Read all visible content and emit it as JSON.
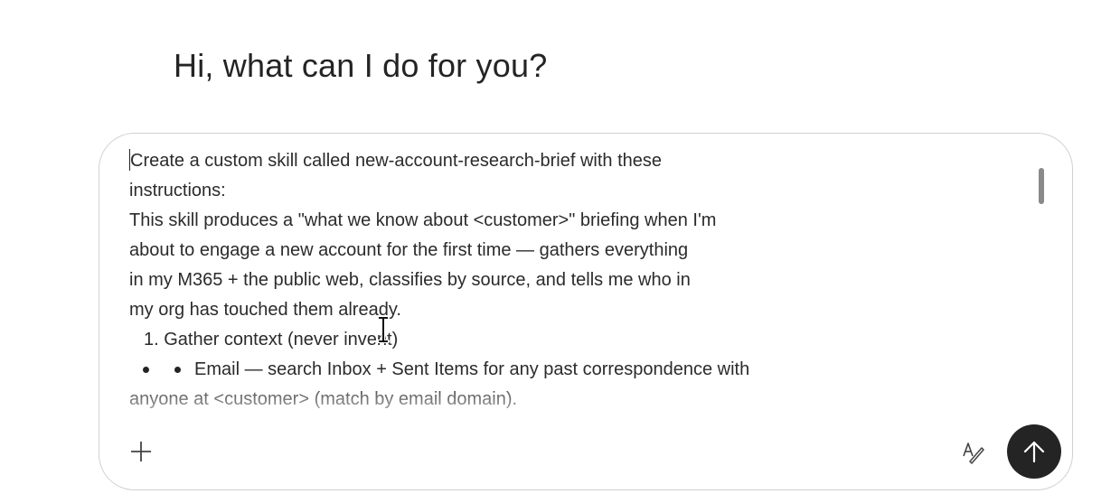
{
  "greeting": "Hi, what can I do for you?",
  "composer": {
    "lines": [
      "Create a custom skill called new-account-research-brief with these",
      "instructions:",
      "This skill produces a \"what we know about <customer>\" briefing when I'm",
      "about to engage a new account for the first time — gathers everything",
      "in my M365 + the public web, classifies by source, and tells me who in",
      "my org has touched them already.",
      "1. Gather context (never invent)",
      "Email — search Inbox + Sent Items for any past correspondence with",
      "anyone at <customer> (match by email domain)."
    ]
  },
  "icons": {
    "plus": "plus-icon",
    "tone": "text-tone-icon",
    "send": "arrow-up-icon",
    "cursor": "text-cursor-icon"
  },
  "colors": {
    "text": "#242424",
    "border": "#d1d1d1",
    "send_bg": "#242424",
    "scrollbar": "#8a8a8a"
  }
}
